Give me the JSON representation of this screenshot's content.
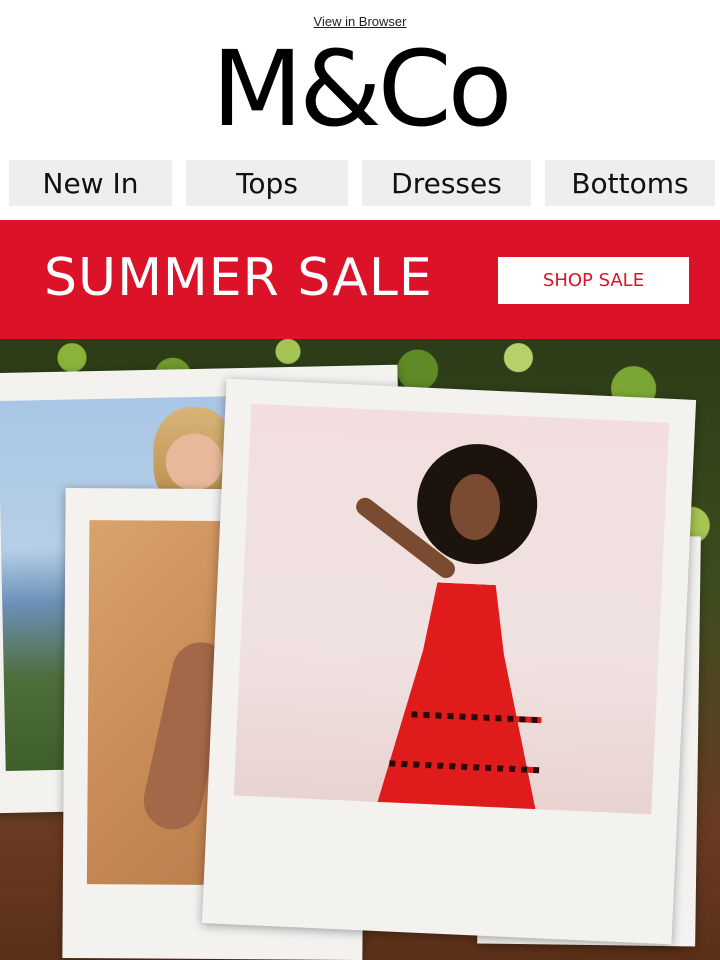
{
  "header": {
    "view_in_browser": "View in Browser",
    "logo_text": "M&Co"
  },
  "nav": {
    "items": [
      {
        "label": "New In"
      },
      {
        "label": "Tops"
      },
      {
        "label": "Dresses"
      },
      {
        "label": "Bottoms"
      }
    ]
  },
  "banner": {
    "title": "SUMMER SALE",
    "cta_label": "SHOP SALE",
    "background_color": "#dc1229"
  },
  "hero": {
    "photos": [
      "woman-blonde-coastal",
      "woman-tan-background",
      "woman-red-dress",
      "partial-photo"
    ]
  }
}
